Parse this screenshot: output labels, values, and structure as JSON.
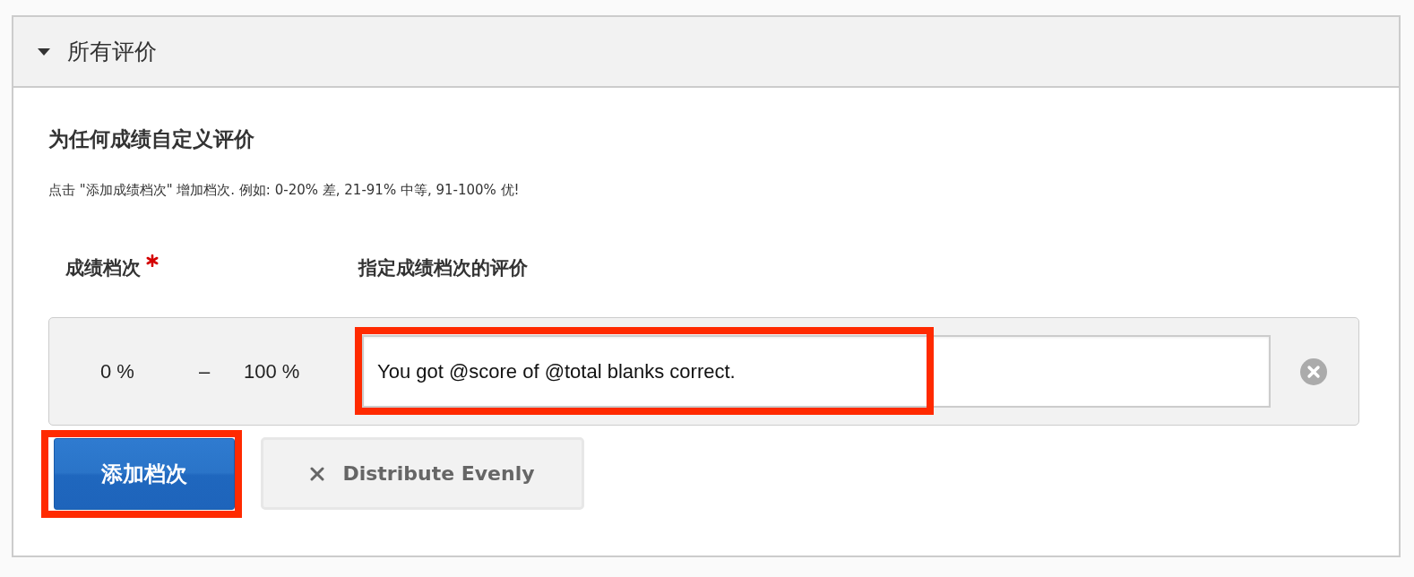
{
  "panel": {
    "title": "所有评价",
    "expanded": true
  },
  "section": {
    "title": "为任何成绩自定义评价",
    "description": "点击 \"添加成绩档次\" 增加档次. 例如: 0-20% 差, 21-91% 中等, 91-100% 优!"
  },
  "columns": [
    {
      "label": "成绩档次",
      "required": true
    },
    {
      "label": "指定成绩档次的评价",
      "required": false
    }
  ],
  "ranges": [
    {
      "from": "0 %",
      "separator": "–",
      "to": "100 %",
      "feedback": "You got @score of @total blanks correct.",
      "highlighted": true
    }
  ],
  "buttons": [
    {
      "kind": "primary",
      "label": "添加档次",
      "highlighted": true
    },
    {
      "kind": "secondary",
      "label": "Distribute Evenly",
      "highlighted": false
    }
  ]
}
